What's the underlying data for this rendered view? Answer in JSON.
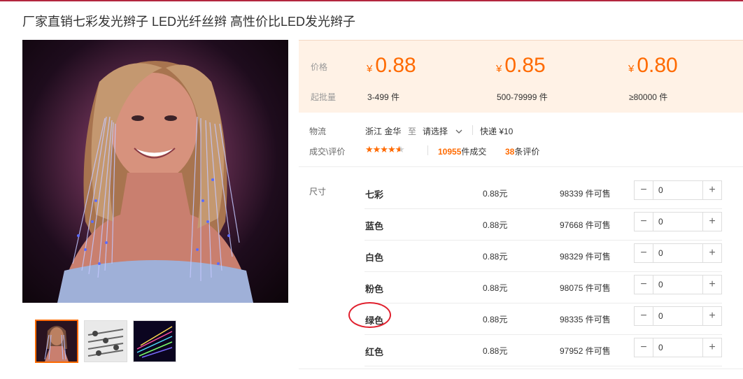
{
  "product": {
    "title": "厂家直销七彩发光辫子 LED光纤丝辫 高性价比LED发光辫子"
  },
  "price_panel": {
    "price_label": "价格",
    "qty_label": "起批量",
    "currency": "¥",
    "tiers": [
      {
        "price": "0.88",
        "qty": "3-499 件"
      },
      {
        "price": "0.85",
        "qty": "500-79999 件"
      },
      {
        "price": "0.80",
        "qty": "≥80000 件"
      }
    ]
  },
  "logistics": {
    "label": "物流",
    "origin": "浙江 金华",
    "to": "至",
    "select": "请选择",
    "shipping": "快递 ¥10"
  },
  "reviews": {
    "label": "成交\\评价",
    "rating": 4.5,
    "deals_count": "10955",
    "deals_suffix": "件成交",
    "review_count": "38",
    "review_suffix": "条评价"
  },
  "sku": {
    "label": "尺寸",
    "rows": [
      {
        "name": "七彩",
        "price": "0.88元",
        "stock": "98339 件可售",
        "qty": "0"
      },
      {
        "name": "蓝色",
        "price": "0.88元",
        "stock": "97668 件可售",
        "qty": "0"
      },
      {
        "name": "白色",
        "price": "0.88元",
        "stock": "98329 件可售",
        "qty": "0"
      },
      {
        "name": "粉色",
        "price": "0.88元",
        "stock": "98075 件可售",
        "qty": "0"
      },
      {
        "name": "绿色",
        "price": "0.88元",
        "stock": "98335 件可售",
        "qty": "0"
      },
      {
        "name": "红色",
        "price": "0.88元",
        "stock": "97952 件可售",
        "qty": "0"
      }
    ]
  },
  "stepper": {
    "minus": "−",
    "plus": "+"
  },
  "colors": {
    "accent": "#ff6a00",
    "price_bg": "#fff2e6",
    "highlight": "#e0202e",
    "top_line": "#b3253e"
  }
}
